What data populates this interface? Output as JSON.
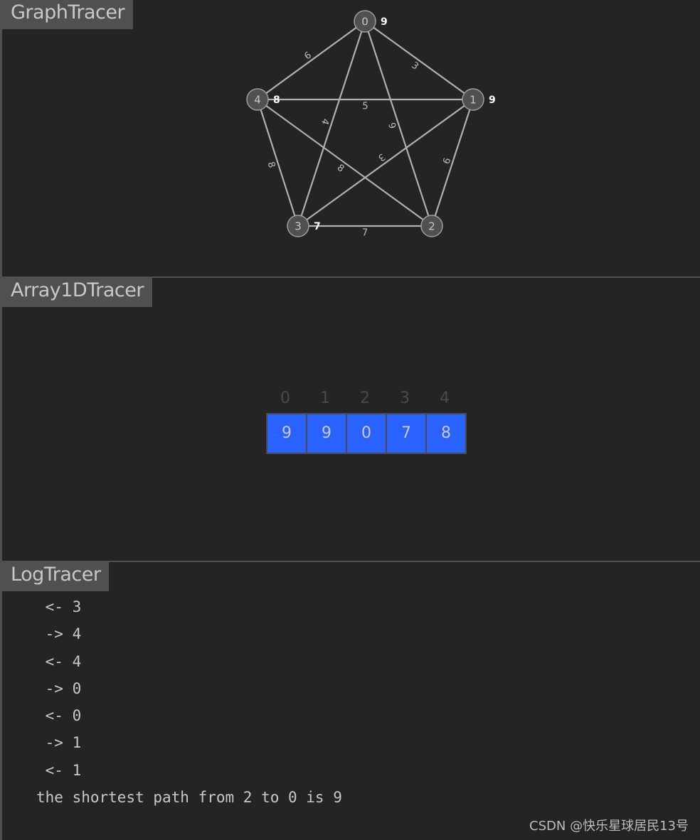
{
  "panels": {
    "graph_title": "GraphTracer",
    "array_title": "Array1DTracer",
    "log_title": "LogTracer"
  },
  "graph": {
    "nodes": [
      {
        "id": "0",
        "weight": "9"
      },
      {
        "id": "1",
        "weight": "9"
      },
      {
        "id": "2",
        "weight": ""
      },
      {
        "id": "3",
        "weight": "7"
      },
      {
        "id": "4",
        "weight": "8"
      }
    ],
    "edges": [
      {
        "from": 0,
        "to": 4,
        "label": "9"
      },
      {
        "from": 0,
        "to": 1,
        "label": "3"
      },
      {
        "from": 4,
        "to": 1,
        "label": "5"
      },
      {
        "from": 0,
        "to": 3,
        "label": "4"
      },
      {
        "from": 0,
        "to": 2,
        "label": "9"
      },
      {
        "from": 1,
        "to": 2,
        "label": "9"
      },
      {
        "from": 4,
        "to": 3,
        "label": "8"
      },
      {
        "from": 4,
        "to": 2,
        "label": "8"
      },
      {
        "from": 1,
        "to": 3,
        "label": "3"
      },
      {
        "from": 3,
        "to": 2,
        "label": "7"
      }
    ],
    "colors": {
      "node_fill": "#505050",
      "node_stroke": "#9e9e9e",
      "edge": "#b0b0b0",
      "weight_text": "#ffffff"
    }
  },
  "array": {
    "indices": [
      "0",
      "1",
      "2",
      "3",
      "4"
    ],
    "values": [
      "9",
      "9",
      "0",
      "7",
      "8"
    ],
    "cell_color": "#2962ff"
  },
  "log": {
    "lines": [
      " <- 3",
      " -> 4",
      " <- 4",
      " -> 0",
      " <- 0",
      " -> 1",
      " <- 1",
      "the shortest path from 2 to 0 is 9"
    ]
  },
  "watermark": "CSDN @快乐星球居民13号"
}
